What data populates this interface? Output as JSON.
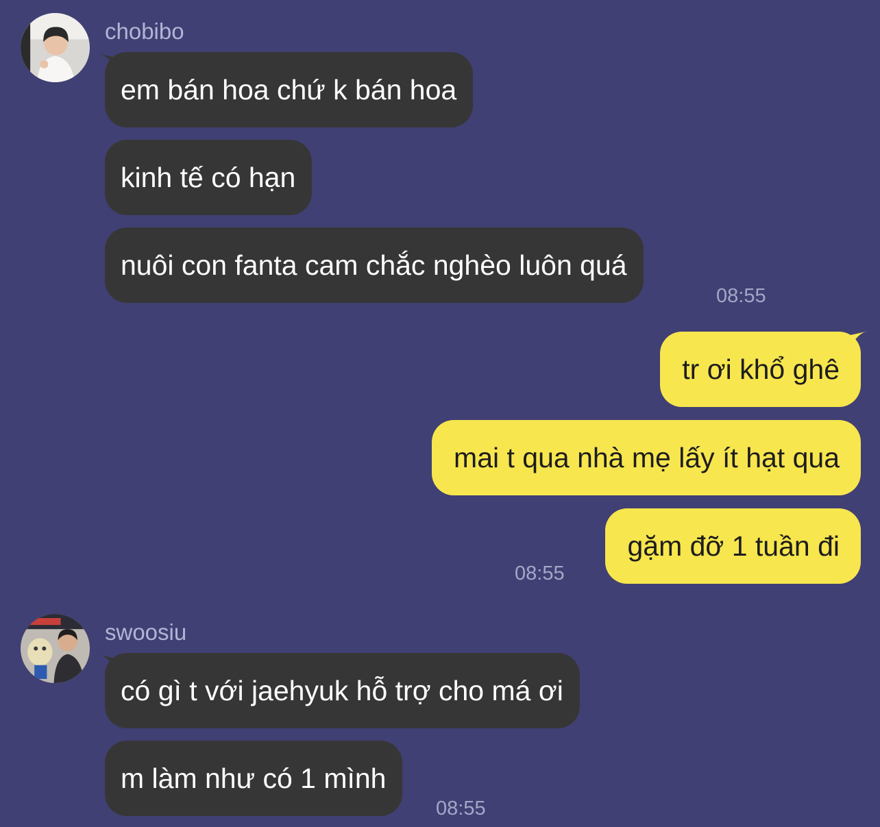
{
  "colors": {
    "background": "#404074",
    "incoming_bubble": "#373637",
    "outgoing_bubble": "#f7e64e",
    "incoming_text": "#ffffff",
    "outgoing_text": "#1d1d1d",
    "meta_text": "#b4b4d6"
  },
  "groups": [
    {
      "sender": "chobibo",
      "avatar_icon": "profile-photo-icon",
      "messages": [
        "em bán hoa chứ k bán hoa",
        "kinh tế có hạn",
        "nuôi con fanta cam chắc nghèo luôn quá"
      ],
      "time": "08:55"
    },
    {
      "sender": "me",
      "messages": [
        "tr ơi khổ ghê",
        "mai t qua nhà mẹ lấy ít hạt qua",
        "gặm đỡ 1 tuần đi"
      ],
      "time": "08:55"
    },
    {
      "sender": "swoosiu",
      "avatar_icon": "profile-photo-icon",
      "messages": [
        "có gì t với jaehyuk hỗ trợ cho má ơi",
        "m làm như có 1 mình"
      ],
      "time": "08:55"
    }
  ]
}
